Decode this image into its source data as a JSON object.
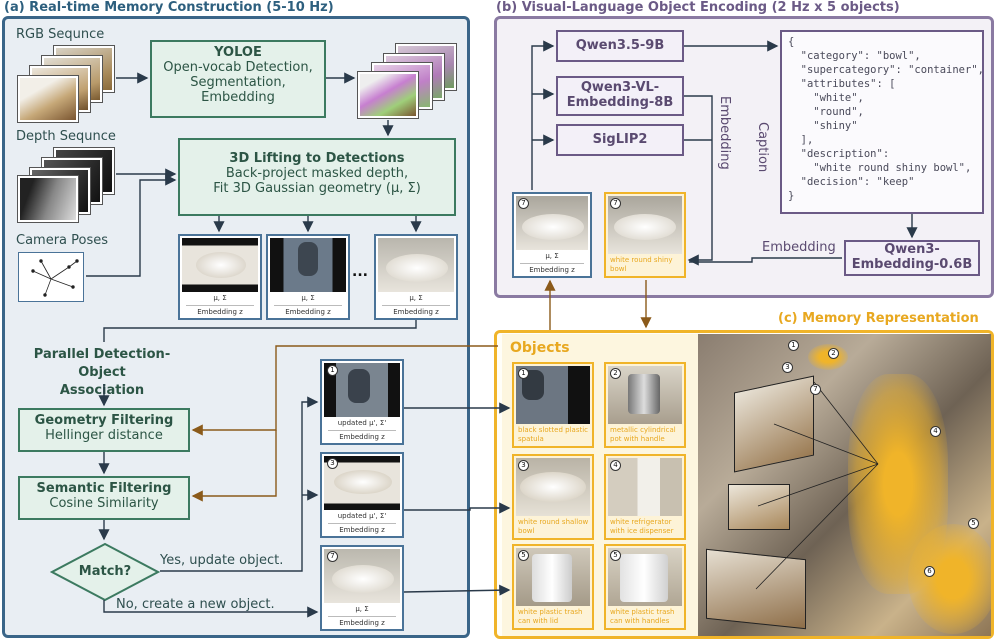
{
  "titles": {
    "a": "(a) Real-time Memory Construction (5-10 Hz)",
    "b": "(b) Visual-Language Object Encoding (2 Hz x 5 objects)",
    "c": "(c) Memory Representation"
  },
  "inputs": {
    "rgb": "RGB Sequnce",
    "depth": "Depth Sequnce",
    "camera": "Camera Poses"
  },
  "yoloe": {
    "title": "YOLOE",
    "lines": [
      "Open-vocab Detection,",
      "Segmentation,",
      "Embedding"
    ]
  },
  "lifting": {
    "title": "3D Lifting to Detections",
    "line1": "Back-project masked depth,",
    "line2": "Fit 3D Gaussian geometry (μ, Σ)"
  },
  "detection_cards": {
    "mu_sigma": "μ, Σ",
    "embedding": "Embedding z",
    "ellipsis": "..."
  },
  "association": {
    "line1": "Parallel Detection-Object",
    "line2": "Association"
  },
  "geometry_filter": {
    "title": "Geometry Filtering",
    "sub": "Hellinger distance"
  },
  "semantic_filter": {
    "title": "Semantic Filtering",
    "sub": "Cosine Similarity"
  },
  "match": {
    "label": "Match?",
    "yes": "Yes, update object.",
    "no": "No, create a new object."
  },
  "object_cards": {
    "updated": "updated μ', Σ'",
    "mu_sigma": "μ, Σ",
    "embedding": "Embedding z",
    "ids": [
      "1",
      "3",
      "7"
    ]
  },
  "vl_encoding": {
    "qwen_vl": "Qwen3.5-9B",
    "qwen_embed": "Qwen3-VL-\nEmbedding-8B",
    "siglip": "SigLIP2",
    "text_embed": "Qwen3-\nEmbedding-0.6B",
    "embedding_label": "Embedding",
    "caption_label": "Caption",
    "embedding_label2": "Embedding",
    "json": "{\n  \"category\": \"bowl\",\n  \"supercategory\": \"container\",\n  \"attributes\": [\n    \"white\",\n    \"round\",\n    \"shiny\"\n  ],\n  \"description\":\n    \"white round shiny bowl\",\n  \"decision\": \"keep\"\n}",
    "card_left": {
      "id": "7",
      "mu_sigma": "μ, Σ",
      "embedding": "Embedding z"
    },
    "card_right": {
      "id": "7",
      "caption": "white round shiny bowl"
    }
  },
  "memory": {
    "objects_heading": "Objects",
    "objects": [
      {
        "id": "1",
        "caption": "black slotted plastic spatula"
      },
      {
        "id": "2",
        "caption": "metallic cylindrical pot with handle"
      },
      {
        "id": "3",
        "caption": "white round shallow bowl"
      },
      {
        "id": "4",
        "caption": "white refrigerator with ice dispenser"
      },
      {
        "id": "5",
        "caption": "white plastic trash can with lid"
      },
      {
        "id": "5",
        "caption": "white plastic trash can with handles"
      }
    ],
    "scene_markers": [
      "1",
      "2",
      "3",
      "7",
      "4",
      "5",
      "6"
    ]
  },
  "colors": {
    "panel_a": "#3a6588",
    "panel_b": "#8a7aa2",
    "panel_c": "#f0b429",
    "arrow_brown": "#8b5a1a",
    "green_box": "#3c7a60"
  }
}
